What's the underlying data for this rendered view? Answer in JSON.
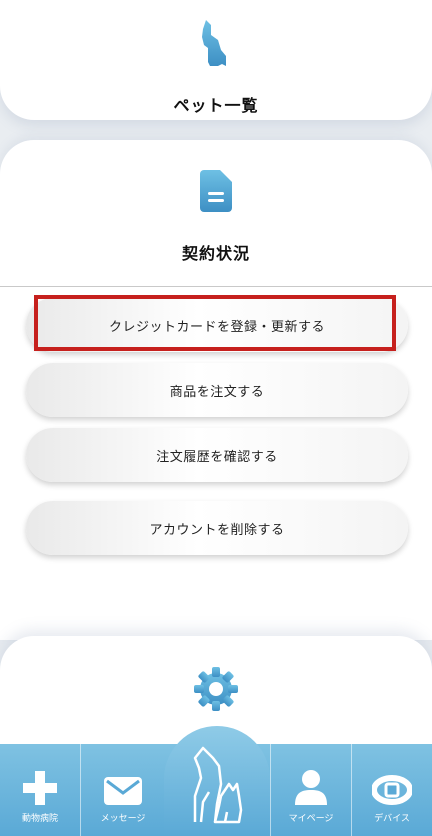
{
  "pets": {
    "title": "ペット一覧",
    "icon": "dog-icon"
  },
  "contract": {
    "title": "契約状況",
    "icon": "document-icon",
    "buttons": [
      "クレジットカードを登録・更新する",
      "商品を注文する",
      "注文履歴を確認する",
      "アカウントを削除する"
    ]
  },
  "settings": {
    "icon": "gear-icon"
  },
  "tabbar": {
    "items": [
      {
        "label": "動物病院",
        "icon": "cross-icon"
      },
      {
        "label": "メッセージ",
        "icon": "envelope-icon"
      },
      {
        "label": "",
        "icon": "dog-cat-logo-icon"
      },
      {
        "label": "マイページ",
        "icon": "person-icon"
      },
      {
        "label": "デバイス",
        "icon": "collar-icon"
      }
    ]
  },
  "colors": {
    "accent": "#5aa9d6",
    "highlight": "#c6201d"
  }
}
